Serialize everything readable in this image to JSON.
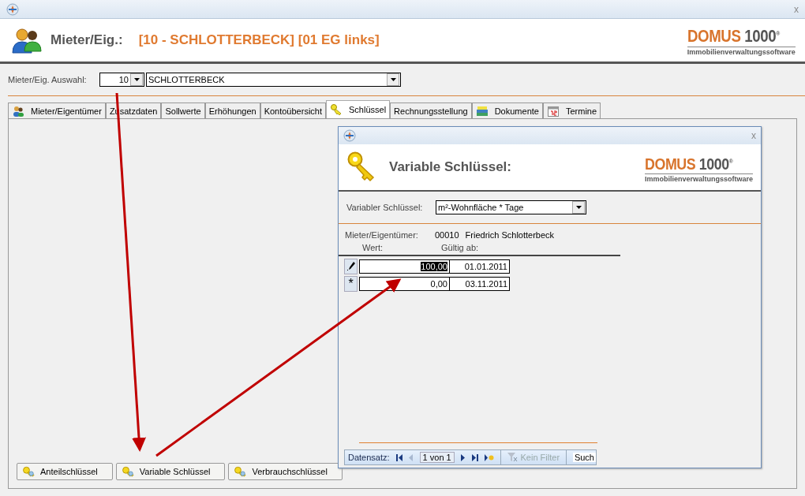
{
  "window": {
    "close": "x"
  },
  "header": {
    "label": "Mieter/Eig.:",
    "record": "[10 - SCHLOTTERBECK] [01 EG links]",
    "logo": {
      "brand": "DOMUS",
      "number": "1000",
      "mark": "®",
      "tagline": "Immobilienverwaltungssoftware"
    }
  },
  "selection": {
    "label": "Mieter/Eig. Auswahl:",
    "code": "10",
    "name": "SCHLOTTERBECK"
  },
  "tabs": [
    {
      "label": "Mieter/Eigentümer",
      "kind": "people",
      "selected": false
    },
    {
      "label": "Zusatzdaten",
      "kind": "text",
      "selected": false
    },
    {
      "label": "Sollwerte",
      "kind": "text",
      "selected": false
    },
    {
      "label": "Erhöhungen",
      "kind": "text",
      "selected": false
    },
    {
      "label": "Kontoübersicht",
      "kind": "text",
      "selected": false
    },
    {
      "label": "Schlüssel",
      "kind": "key",
      "selected": true
    },
    {
      "label": "Rechnungsstellung",
      "kind": "text",
      "selected": false
    },
    {
      "label": "Dokumente",
      "kind": "documents",
      "selected": false
    },
    {
      "label": "Termine",
      "kind": "calendar",
      "selected": false
    }
  ],
  "dialog": {
    "close": "x",
    "title": "Variable Schlüssel:",
    "logo": {
      "brand": "DOMUS",
      "number": "1000",
      "mark": "®",
      "tagline": "Immobilienverwaltungssoftware"
    },
    "key_field": {
      "label": "Variabler Schlüssel:",
      "value": "m²-Wohnfläche * Tage"
    },
    "owner": {
      "label": "Mieter/Eigentümer:",
      "number": "00010",
      "name": "Friedrich Schlotterbeck"
    },
    "columns": [
      "Wert:",
      "Gültig ab:"
    ],
    "rows": [
      {
        "kind": "edit",
        "value": "100,00",
        "date": "01.01.2011",
        "selected": true
      },
      {
        "kind": "new",
        "marker": "*",
        "value": "0,00",
        "date": "03.11.2011",
        "selected": false
      }
    ],
    "navigator": {
      "label": "Datensatz:",
      "position": "1 von 1",
      "filter": {
        "label": "Kein Filter",
        "disabled": true
      },
      "search": "Such"
    }
  },
  "buttons": [
    "Anteilschlüssel",
    "Variable Schlüssel",
    "Verbrauchschlüssel"
  ]
}
